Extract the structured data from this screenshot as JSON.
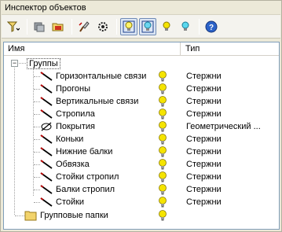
{
  "window": {
    "title": "Инспектор объектов"
  },
  "toolbar": {
    "buttons": [
      {
        "icon": "filter-funnel-icon"
      },
      {
        "icon": "copy-objects-icon"
      },
      {
        "icon": "open-folder-icon"
      },
      {
        "icon": "brush-tool-icon"
      },
      {
        "icon": "settings-gear-icon"
      },
      {
        "icon": "bulb-on-frame-icon",
        "pressed": true
      },
      {
        "icon": "bulb-color-frame-icon",
        "pressed": true
      },
      {
        "icon": "bulb-yellow-icon"
      },
      {
        "icon": "bulb-cyan-icon"
      },
      {
        "icon": "help-icon"
      }
    ]
  },
  "columns": {
    "name": "Имя",
    "type": "Тип"
  },
  "tree": {
    "root": {
      "label": "Группы",
      "expander": "−"
    },
    "items": [
      {
        "label": "Горизонтальные связи",
        "type": "Стержни",
        "icon": "rod-icon"
      },
      {
        "label": "Прогоны",
        "type": "Стержни",
        "icon": "rod-icon"
      },
      {
        "label": "Вертикальные связи",
        "type": "Стержни",
        "icon": "rod-icon"
      },
      {
        "label": "Стропила",
        "type": "Стержни",
        "icon": "rod-icon"
      },
      {
        "label": "Покрытия",
        "type": "Геометрический ...",
        "icon": "geometry-icon"
      },
      {
        "label": "Коньки",
        "type": "Стержни",
        "icon": "rod-icon"
      },
      {
        "label": "Нижние балки",
        "type": "Стержни",
        "icon": "rod-icon"
      },
      {
        "label": "Обвязка",
        "type": "Стержни",
        "icon": "rod-icon"
      },
      {
        "label": "Стойки стропил",
        "type": "Стержни",
        "icon": "rod-icon"
      },
      {
        "label": "Балки стропил",
        "type": "Стержни",
        "icon": "rod-icon"
      },
      {
        "label": "Стойки",
        "type": "Стержни",
        "icon": "rod-icon"
      }
    ],
    "folders": {
      "label": "Групповые папки",
      "icon": "folder-icon"
    }
  },
  "colors": {
    "bulb": "#f5e400",
    "folder": "#f2d36b",
    "rod": "#000000",
    "rod_accent": "#c00000"
  }
}
